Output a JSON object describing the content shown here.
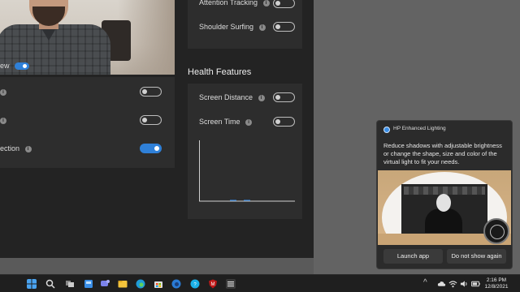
{
  "app": {
    "preview_label": "ew",
    "left_settings": [
      {
        "label": "",
        "state": "off"
      },
      {
        "label": "",
        "state": "off"
      },
      {
        "label": "ection",
        "state": "on"
      }
    ],
    "privacy_settings": [
      {
        "label": "Attention Tracking",
        "state": "off"
      },
      {
        "label": "Shoulder Surfing",
        "state": "off"
      }
    ],
    "health_title": "Health Features",
    "health_settings": [
      {
        "label": "Screen Distance",
        "state": "off"
      },
      {
        "label": "Screen Time",
        "state": "off"
      }
    ]
  },
  "notification": {
    "app_name": "HP Enhanced Lighting",
    "message": "Reduce shadows with adjustable brightness or change the shape, size and color of the virtual light to fit your needs.",
    "buttons": {
      "launch": "Launch app",
      "dismiss": "Do not show again"
    }
  },
  "taskbar": {
    "icons": [
      "windows-start-icon",
      "search-icon",
      "task-view-icon",
      "widgets-icon",
      "teams-chat-icon",
      "file-explorer-icon",
      "edge-icon",
      "store-icon",
      "edge-beta-icon",
      "hp-support-icon",
      "mcafee-icon",
      "settings-app-icon"
    ],
    "tray": [
      "chevron-up-icon",
      "cloud-icon",
      "wifi-icon",
      "volume-icon",
      "battery-icon"
    ],
    "time": "2:16 PM",
    "date": "12/8/2021"
  },
  "colors": {
    "accent": "#2f80d8",
    "panel": "#2d2d2d",
    "window": "#232323"
  }
}
